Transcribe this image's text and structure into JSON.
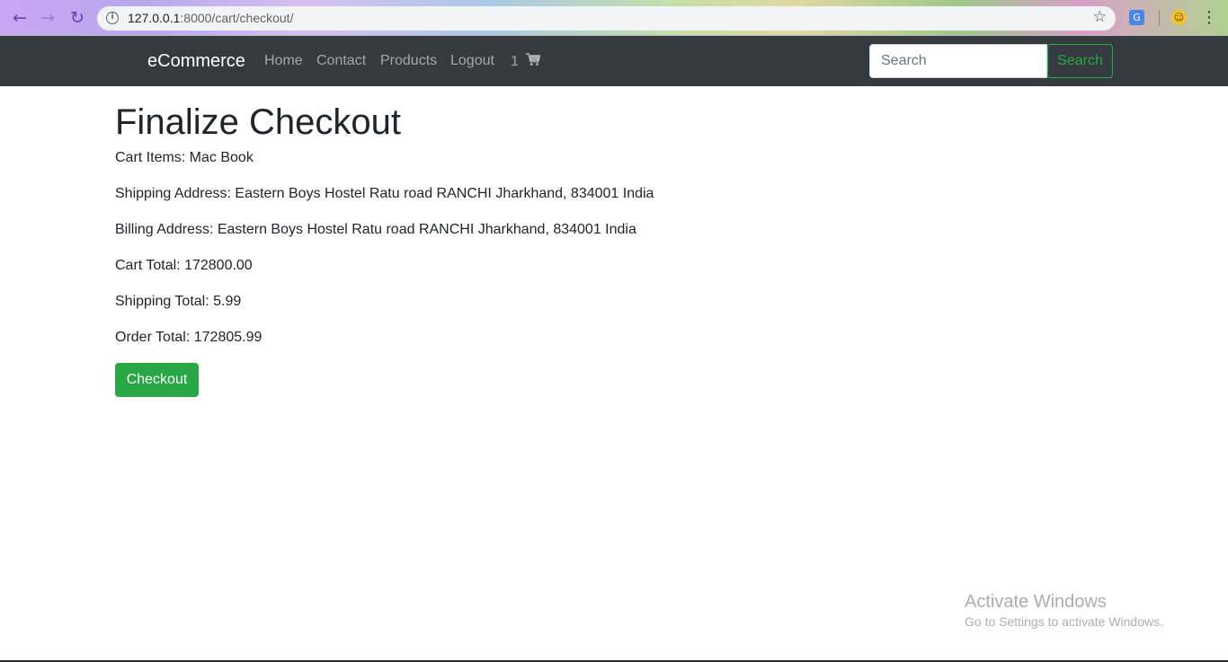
{
  "browser": {
    "url_host": "127.0.0.1",
    "url_path": ":8000/cart/checkout/",
    "icons": [
      "back-arrow-icon",
      "forward-arrow-icon",
      "reload-icon",
      "info-icon",
      "star-icon",
      "translate-icon",
      "avatar-icon",
      "menu-dots-icon"
    ]
  },
  "navbar": {
    "brand": "eCommerce",
    "links": [
      "Home",
      "Contact",
      "Products",
      "Logout"
    ],
    "cart_count": "1",
    "search_placeholder": "Search",
    "search_button": "Search"
  },
  "main": {
    "title": "Finalize Checkout",
    "cart_items": "Cart Items: Mac Book",
    "shipping_address": "Shipping Address: Eastern Boys Hostel Ratu road RANCHI Jharkhand, 834001 India",
    "billing_address": "Billing Address: Eastern Boys Hostel Ratu road RANCHI Jharkhand, 834001 India",
    "cart_total": "Cart Total: 172800.00",
    "shipping_total": "Shipping Total: 5.99",
    "order_total": "Order Total: 172805.99",
    "checkout_button": "Checkout"
  },
  "watermark": {
    "title": "Activate Windows",
    "subtitle": "Go to Settings to activate Windows."
  },
  "colors": {
    "navbar_bg": "#343a40",
    "success": "#28a745",
    "text": "#212529"
  }
}
